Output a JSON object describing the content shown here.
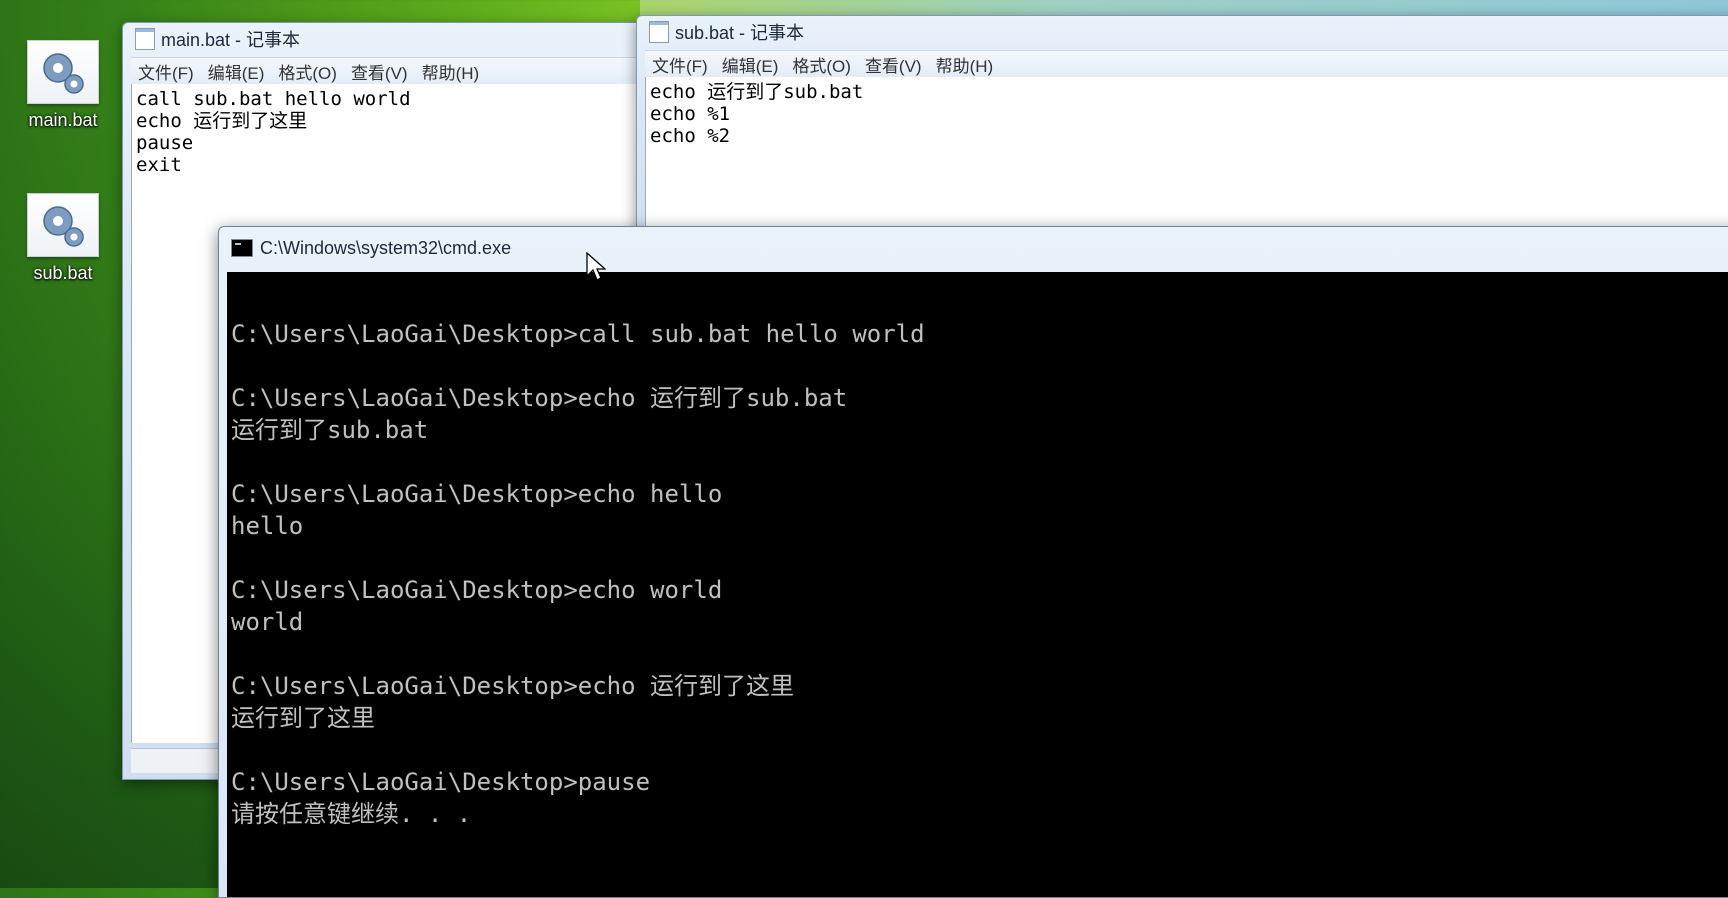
{
  "desktop": {
    "icons": [
      {
        "label": "main.bat"
      },
      {
        "label": "sub.bat"
      }
    ]
  },
  "main_notepad": {
    "title": "main.bat - 记事本",
    "menu": [
      "文件(F)",
      "编辑(E)",
      "格式(O)",
      "查看(V)",
      "帮助(H)"
    ],
    "lines": [
      "call sub.bat hello world",
      "echo 运行到了这里",
      "pause",
      "exit"
    ]
  },
  "sub_notepad": {
    "title": "sub.bat - 记事本",
    "menu": [
      "文件(F)",
      "编辑(E)",
      "格式(O)",
      "查看(V)",
      "帮助(H)"
    ],
    "lines": [
      "echo 运行到了sub.bat",
      "echo %1",
      "echo %2"
    ]
  },
  "cmd": {
    "title": "C:\\Windows\\system32\\cmd.exe",
    "lines": [
      "",
      "C:\\Users\\LaoGai\\Desktop>call sub.bat hello world",
      "",
      "C:\\Users\\LaoGai\\Desktop>echo 运行到了sub.bat",
      "运行到了sub.bat",
      "",
      "C:\\Users\\LaoGai\\Desktop>echo hello",
      "hello",
      "",
      "C:\\Users\\LaoGai\\Desktop>echo world",
      "world",
      "",
      "C:\\Users\\LaoGai\\Desktop>echo 运行到了这里",
      "运行到了这里",
      "",
      "C:\\Users\\LaoGai\\Desktop>pause",
      "请按任意键继续. . ."
    ]
  }
}
